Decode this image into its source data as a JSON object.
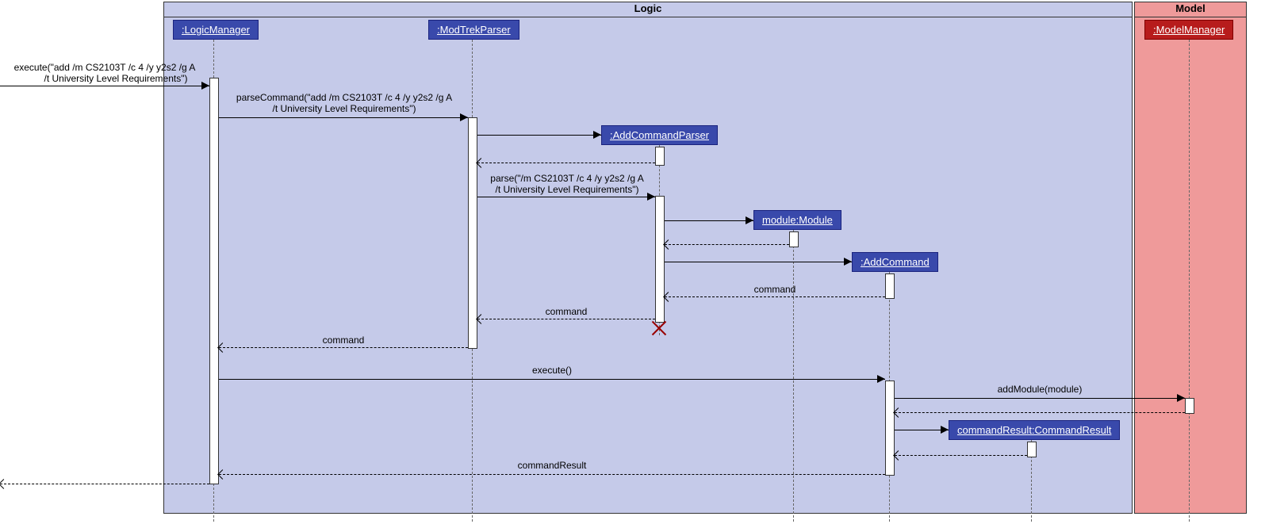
{
  "frames": {
    "logic": "Logic",
    "model": "Model"
  },
  "participants": {
    "logic_manager": ":LogicManager",
    "modtrek_parser": ":ModTrekParser",
    "add_cmd_parser": ":AddCommandParser",
    "module": "module:Module",
    "add_command": ":AddCommand",
    "command_result": "commandResult:CommandResult",
    "model_manager": ":ModelManager"
  },
  "messages": {
    "m1a": "execute(\"add /m CS2103T /c 4 /y y2s2 /g A",
    "m1b": "/t University Level Requirements\")",
    "m2a": "parseCommand(\"add /m CS2103T /c 4 /y y2s2 /g A",
    "m2b": "/t University Level Requirements\")",
    "m3a": "parse(\"/m CS2103T /c 4 /y y2s2 /g A",
    "m3b": "/t University Level Requirements\")",
    "ret_command_to_mtp": "command",
    "ret_command_to_lm": "command",
    "ret_command_label": "command",
    "m_execute": "execute()",
    "m_add_module": "addModule(module)",
    "ret_cmd_result": "commandResult"
  }
}
